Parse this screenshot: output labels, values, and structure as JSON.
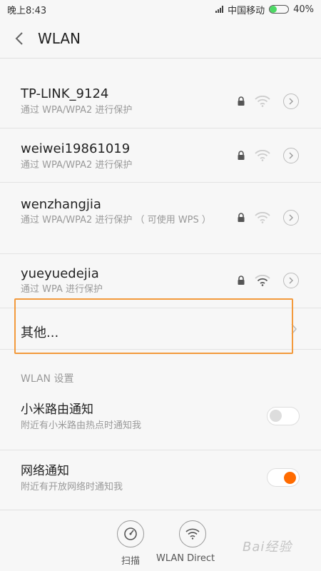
{
  "status_bar": {
    "time": "晚上8:43",
    "carrier": "中国移动",
    "battery": "40%",
    "battery_level": 0.4,
    "battery_color": "#4cd964"
  },
  "header": {
    "back_icon": "chevron-left-icon",
    "title": "WLAN"
  },
  "networks": [
    {
      "ssid": "TP-LINK_9124",
      "security": "通过 WPA/WPA2 进行保护"
    },
    {
      "ssid": "weiwei19861019",
      "security": "通过 WPA/WPA2 进行保护"
    },
    {
      "ssid": "wenzhangjia",
      "security": "通过 WPA/WPA2 进行保护 （ 可使用 WPS ）"
    },
    {
      "ssid": "yueyuedejia",
      "security": "通过 WPA 进行保护"
    }
  ],
  "other": {
    "label": "其他...",
    "highlight_color": "#f39a3c"
  },
  "settings": {
    "section_title": "WLAN 设置",
    "items": [
      {
        "title": "小米路由通知",
        "subtitle": "附近有小米路由热点时通知我",
        "enabled": false
      },
      {
        "title": "网络通知",
        "subtitle": "附近有开放网络时通知我",
        "enabled": true
      }
    ],
    "accent_color": "#ff6b00"
  },
  "bottom_bar": {
    "scan_label": "扫描",
    "wlan_direct_label": "WLAN Direct"
  },
  "watermark": "Bai经验"
}
